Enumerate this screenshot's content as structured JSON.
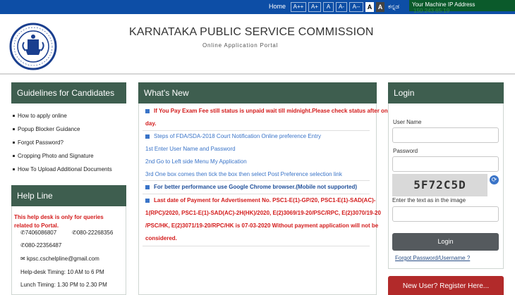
{
  "topbar": {
    "home": "Home",
    "font_sizes": [
      "A++",
      "A+",
      "A",
      "A-",
      "A--"
    ],
    "contrast": [
      "A",
      "A"
    ],
    "kannada": "ಕನ್ನಡ",
    "ip_label": "Your Machine IP Address",
    "ip_value": "150.243.65.19",
    "colors": {
      "bar": "#0d4ea6",
      "ip_box": "#0b5a2b"
    }
  },
  "header": {
    "title": "KARNATAKA PUBLIC SERVICE COMMISSION",
    "subtitle": "Online Application Portal",
    "logo": "kpsc-seal-logo"
  },
  "guidelines": {
    "title": "Guidelines for Candidates",
    "items": [
      "How to apply online",
      "Popup Blocker Guidance",
      "Forgot Password?",
      "Cropping Photo and Signature",
      "How To Upload Additional Documents"
    ]
  },
  "helpline": {
    "title": "Help Line",
    "notice": "This help desk is only for queries related to Portal.",
    "phone1": "7406086807",
    "phone2": "080-22268356",
    "phone3": "080-22356487",
    "email": "kpsc.cschelpline@gmail.com",
    "timing": "Help-desk Timing: 10 AM to 6 PM",
    "lunch": "Lunch Timing: 1.30 PM to 2.30 PM"
  },
  "whats_new": {
    "title": "What's New",
    "item1_l1": "If You Pay Exam Fee still status is unpaid wait till midnight.Please check status after one",
    "item1_l2": "day.",
    "item2": "Steps of FDA/SDA-2018 Court Notification Online preference Entry",
    "item2_s1": "1st Enter User Name and Password",
    "item2_s2": "2nd Go to Left side Menu My Application",
    "item2_s3": "3rd One box comes then tick the box then select Post Preference selection link",
    "item3": "For better performance use Google Chrome browser.(Mobile not supported)",
    "item4_l1": "Last date of Payment for Advertisement No. PSC1-E(1)-GP/20, PSC1-E(1)-SAD(AC)-",
    "item4_l2": "1(RPC)/2020, PSC1-E(1)-SAD(AC)-2H(HK)/2020, E(2)3069/19-20/PSC/RPC, E(2)3070/19-20",
    "item4_l3": "/PSC/HK, E(2)3071/19-20/RPC/HK is 07-03-2020 Without payment application will not be",
    "item4_l4": "considered."
  },
  "login": {
    "title": "Login",
    "username_label": "User Name",
    "password_label": "Password",
    "captcha_text": "5F72C5D",
    "captcha_label": "Enter the text as in the image",
    "login_button": "Login",
    "forgot_link": "Forgot Password/Username ?",
    "register": "New User? Register Here..."
  }
}
